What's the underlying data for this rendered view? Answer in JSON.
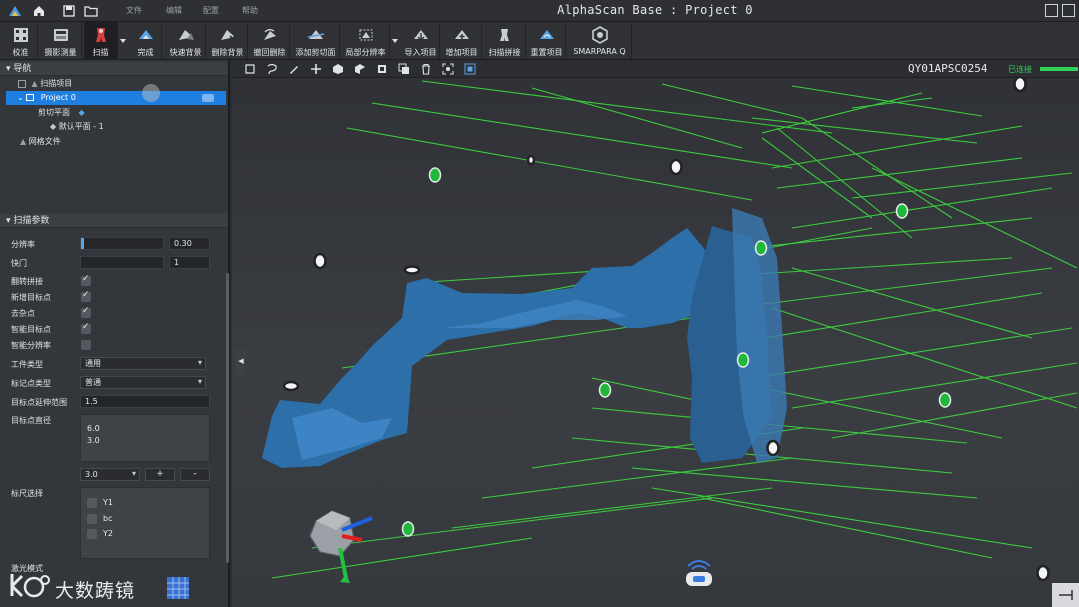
{
  "app": {
    "title": "AlphaScan Base : Project 0"
  },
  "menu": [
    "文件",
    "编辑",
    "配置",
    "帮助"
  ],
  "ribbon": [
    {
      "label": "校准"
    },
    {
      "label": "摄影测量"
    },
    {
      "label": "扫描"
    },
    {
      "label": "完成"
    },
    {
      "label": "快速背景"
    },
    {
      "label": "删除背景"
    },
    {
      "label": "撤回删除"
    },
    {
      "label": "添加剪切面"
    },
    {
      "label": "局部分辨率"
    },
    {
      "label": "导入项目"
    },
    {
      "label": "增加项目"
    },
    {
      "label": "扫描拼接"
    },
    {
      "label": "重置项目"
    },
    {
      "label": "SMARPARA Q"
    }
  ],
  "nav": {
    "title": "导航",
    "items": [
      "扫描项目",
      "Project 0",
      "剪切平面",
      "默认平面 - 1",
      "网格文件"
    ]
  },
  "params": {
    "title": "扫描参数",
    "resolution_label": "分辨率",
    "resolution_value": "0.30",
    "threshold_label": "快门",
    "threshold_value": "1",
    "flip_stitch": "翻转拼接",
    "new_targets": "新增目标点",
    "denoise": "去杂点",
    "smart_targets": "智能目标点",
    "smart_resolution": "智能分辨率",
    "workpiece_type_label": "工件类型",
    "workpiece_type_value": "通用",
    "marker_type_label": "标记点类型",
    "marker_type_value": "普通",
    "target_range_label": "目标点延伸范围",
    "target_range_value": "1.5",
    "target_diameter_label": "目标点直径",
    "target_diameters": [
      "6.0",
      "3.0"
    ],
    "diameter_select": "3.0",
    "add_btn": "+",
    "remove_btn": "-",
    "scale_label": "标尺选择",
    "scale_items": [
      "Y1",
      "bc",
      "Y2"
    ],
    "laser_mode_label": "激光模式"
  },
  "viewport": {
    "device_id": "QY01APSC0254",
    "status": "已连接"
  },
  "watermark": "大数踌镜",
  "colors": {
    "accent": "#1f7fe0",
    "laser": "#3ee63e",
    "connected": "#2fd25a",
    "mesh": "#2d6fa8"
  }
}
